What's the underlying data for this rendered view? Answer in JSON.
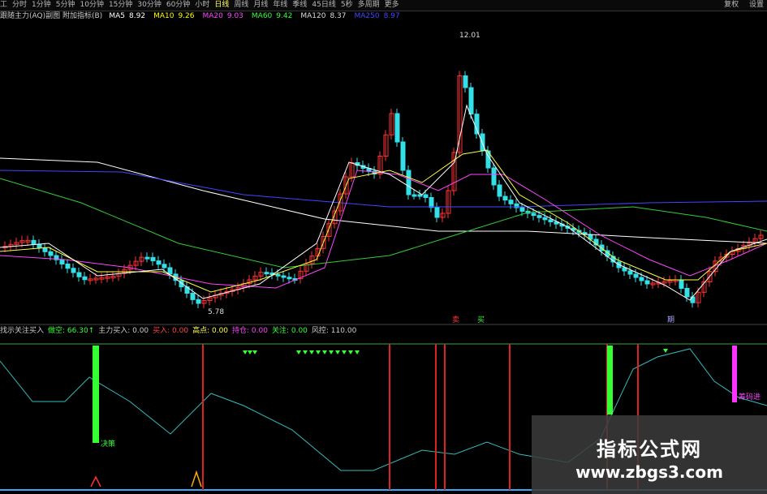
{
  "toolbar": {
    "items": [
      "工",
      "分时",
      "1分钟",
      "5分钟",
      "10分钟",
      "15分钟",
      "30分钟",
      "60分钟",
      "小时",
      "日线",
      "周线",
      "月线",
      "年线",
      "季线",
      "45日线",
      "5秒",
      "多周期",
      "更多"
    ],
    "active_index": 9,
    "right": [
      "复权",
      "设置"
    ]
  },
  "ma_bar": {
    "prefix": "跟随主力(AQ)副图 附加指标(B)",
    "items": [
      {
        "label": "MA5",
        "value": "8.92",
        "color": "#ffffff"
      },
      {
        "label": "MA10",
        "value": "9.26",
        "color": "#ffff00"
      },
      {
        "label": "MA20",
        "value": "9.03",
        "color": "#ff44ff"
      },
      {
        "label": "MA60",
        "value": "9.42",
        "color": "#33ff33"
      },
      {
        "label": "MA120",
        "value": "8.37",
        "color": "#dddddd"
      },
      {
        "label": "MA250",
        "value": "8.97",
        "color": "#4444ff"
      }
    ]
  },
  "price_labels": {
    "high": "12.01",
    "low": "5.78"
  },
  "signals": {
    "sell": "卖",
    "buy": "买",
    "note": "期"
  },
  "indicator_bar": {
    "items": [
      {
        "text": "找示关注买入",
        "color": "#cccccc"
      },
      {
        "text": "做空: 66.30↑",
        "color": "#33ff33"
      },
      {
        "text": "主力买入: 0.00",
        "color": "#cccccc"
      },
      {
        "text": "买入: 0.00",
        "color": "#ff4444"
      },
      {
        "text": "高点: 0.00",
        "color": "#ffff44"
      },
      {
        "text": "持仓: 0.00",
        "color": "#ff44ff"
      },
      {
        "text": "关注: 0.00",
        "color": "#33ff33"
      },
      {
        "text": "风控: 110.00",
        "color": "#cccccc"
      }
    ]
  },
  "indicator_labels": {
    "green_bar": "决策",
    "magenta_bar": "筹码进"
  },
  "watermark": {
    "title": "指标公式网",
    "url": "www.zbgs3.com"
  }
}
